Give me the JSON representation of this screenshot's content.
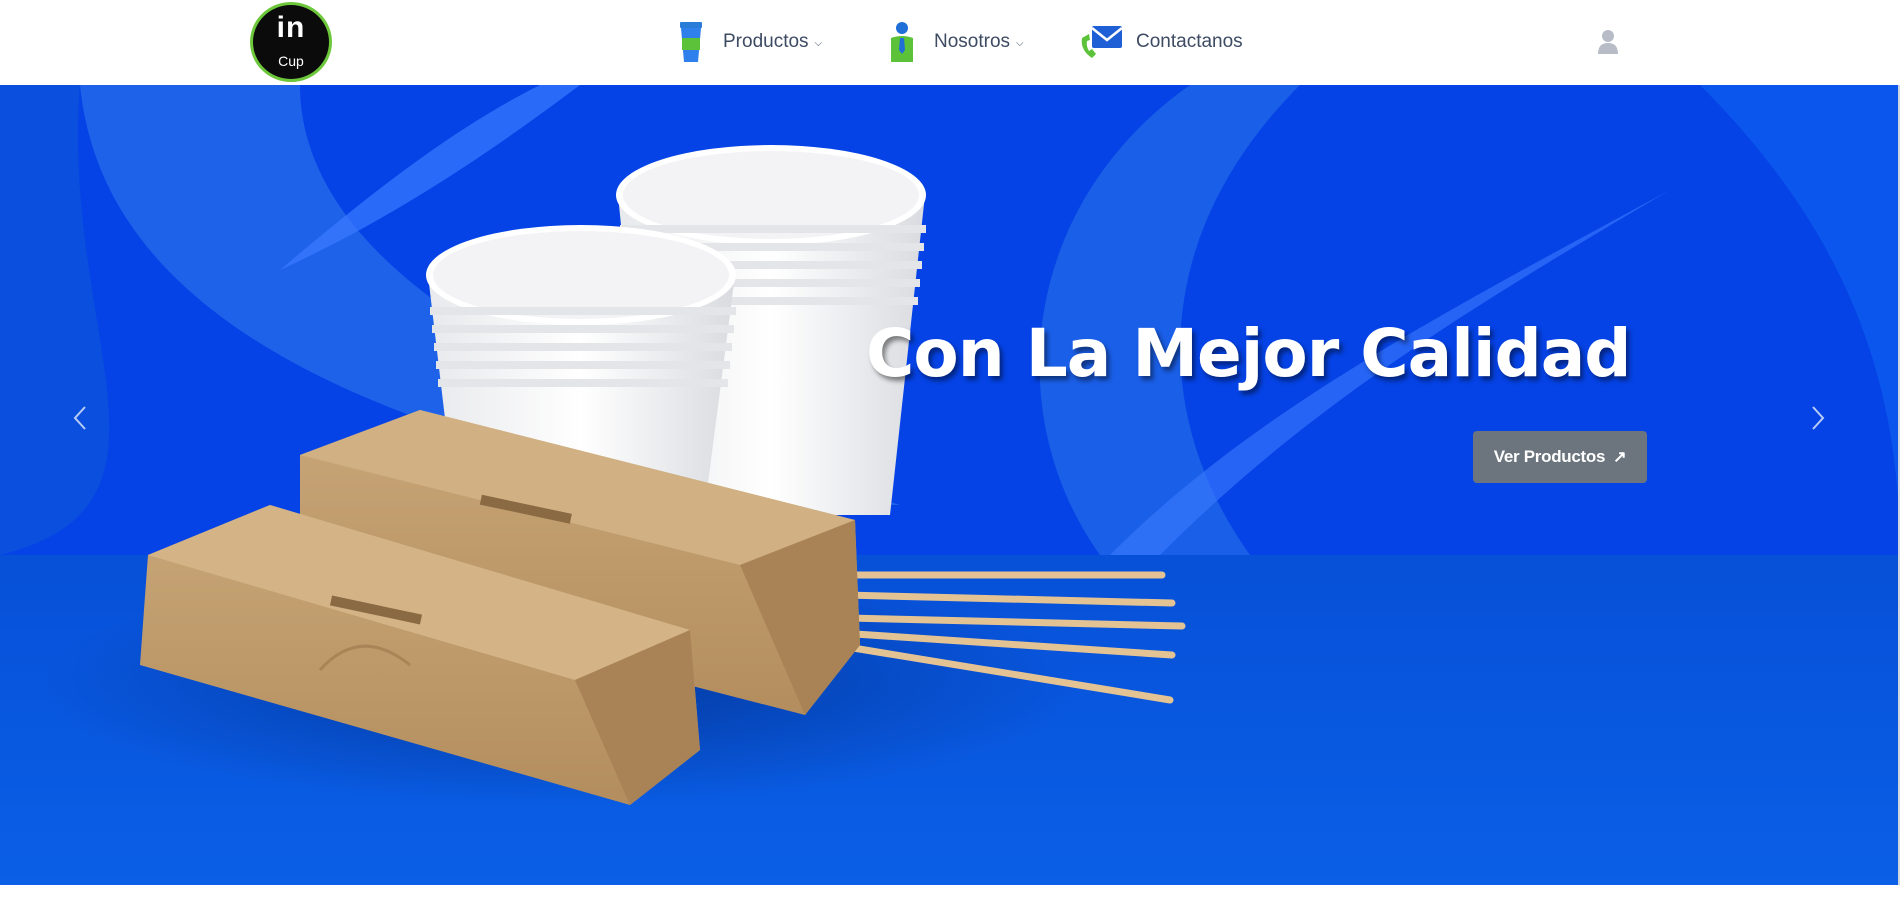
{
  "brand": {
    "logo_main": "in",
    "logo_sub": "Cup",
    "accent": "#6dc73a"
  },
  "nav": {
    "items": [
      {
        "label": "Productos",
        "icon": "cup-icon",
        "has_dropdown": true
      },
      {
        "label": "Nosotros",
        "icon": "person-icon",
        "has_dropdown": true
      },
      {
        "label": "Contactanos",
        "icon": "mail-phone-icon",
        "has_dropdown": false
      }
    ],
    "user_icon": "user-icon"
  },
  "hero": {
    "title": "Con La Mejor Calidad",
    "button_label": "Ver Productos",
    "button_icon": "arrow-up-right-icon",
    "background_color": "#0a4fe0",
    "prev_icon": "chevron-left-icon",
    "next_icon": "chevron-right-icon"
  },
  "colors": {
    "nav_text": "#3d4b63",
    "button_bg": "#6c757d",
    "hero_blue": "#0a4fe0"
  }
}
